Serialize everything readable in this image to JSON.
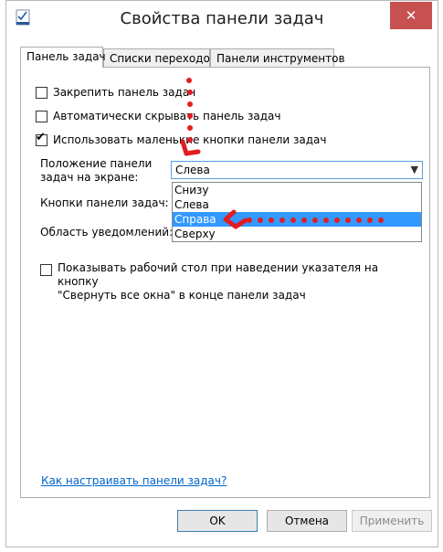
{
  "window": {
    "title": "Свойства панели задач",
    "close_glyph": "✕"
  },
  "tabs": [
    {
      "label": "Панель задач"
    },
    {
      "label": "Списки переходов"
    },
    {
      "label": "Панели инструментов"
    }
  ],
  "checkboxes": {
    "lock": {
      "label": "Закрепить панель задач",
      "checked": false
    },
    "autohide": {
      "label": "Автоматически скрывать панель задач",
      "checked": false
    },
    "small_buttons": {
      "label": "Использовать маленькие кнопки панели задач",
      "checked": true,
      "mark": "✔"
    }
  },
  "position": {
    "label_line1": "Положение панели",
    "label_line2": "задач на экране:",
    "value": "Слева",
    "arrow": "▼",
    "options": [
      "Снизу",
      "Слева",
      "Справа",
      "Сверху"
    ],
    "highlighted": "Справа"
  },
  "buttons_label": "Кнопки панели задач:",
  "notify_label": "Область уведомлений:",
  "peek": {
    "line1": "Показывать рабочий стол при наведении указателя на кнопку",
    "line2": "\"Свернуть все окна\" в конце панели задач",
    "checked": false
  },
  "help_link": "Как настраивать панели задач?",
  "footer": {
    "ok": "OK",
    "cancel": "Отмена",
    "apply": "Применить"
  },
  "annotation_color": "#e21c21"
}
